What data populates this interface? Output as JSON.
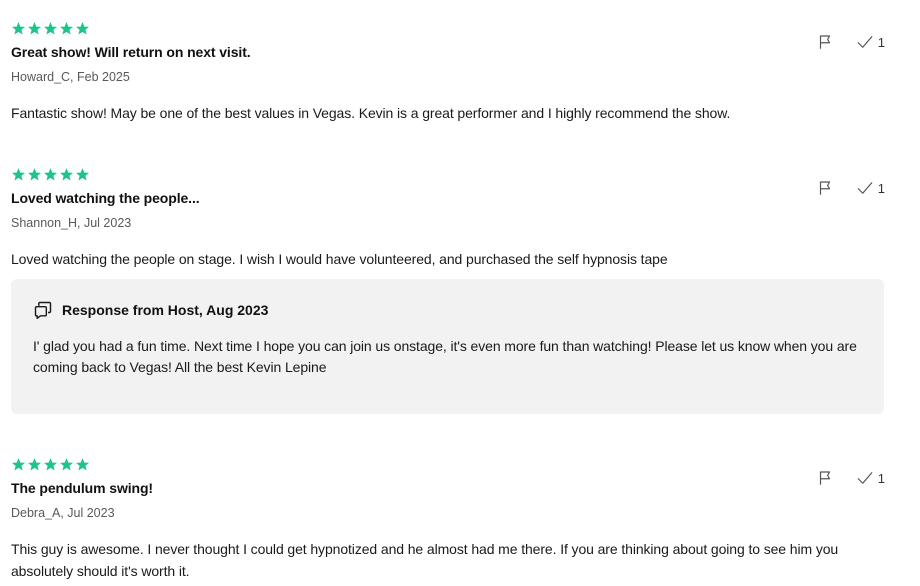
{
  "reviews": [
    {
      "rating": 5,
      "title": "Great show! Will return on next visit.",
      "meta": "Howard_C, Feb 2025",
      "body": "Fantastic show! May be one of the best values in Vegas. Kevin is a great performer and I highly recommend the show.",
      "helpful_count": "1"
    },
    {
      "rating": 5,
      "title": "Loved watching the people...",
      "meta": "Shannon_H, Jul 2023",
      "body": "Loved watching the people on stage. I wish I would have volunteered, and purchased the self hypnosis tape",
      "helpful_count": "1",
      "response": {
        "title": "Response from Host, Aug 2023",
        "text": "I' glad you had a fun time. Next time I hope you can join us onstage, it's even more fun than watching! Please let us know when you are coming back to Vegas! All the best Kevin Lepine"
      }
    },
    {
      "rating": 5,
      "title": "The pendulum swing!",
      "meta": "Debra_A, Jul 2023",
      "body": "This guy is awesome. I never thought I could get hypnotized and he almost had me there. If you are thinking about going to see him you absolutely should it's worth it.",
      "helpful_count": "1"
    }
  ],
  "colors": {
    "star": "#1ec28b",
    "response_bg": "#f2f2f2"
  },
  "icons": {
    "rating": "star-icon",
    "report": "flag-icon",
    "helpful": "check-icon",
    "response": "chat-bubble-icon"
  }
}
